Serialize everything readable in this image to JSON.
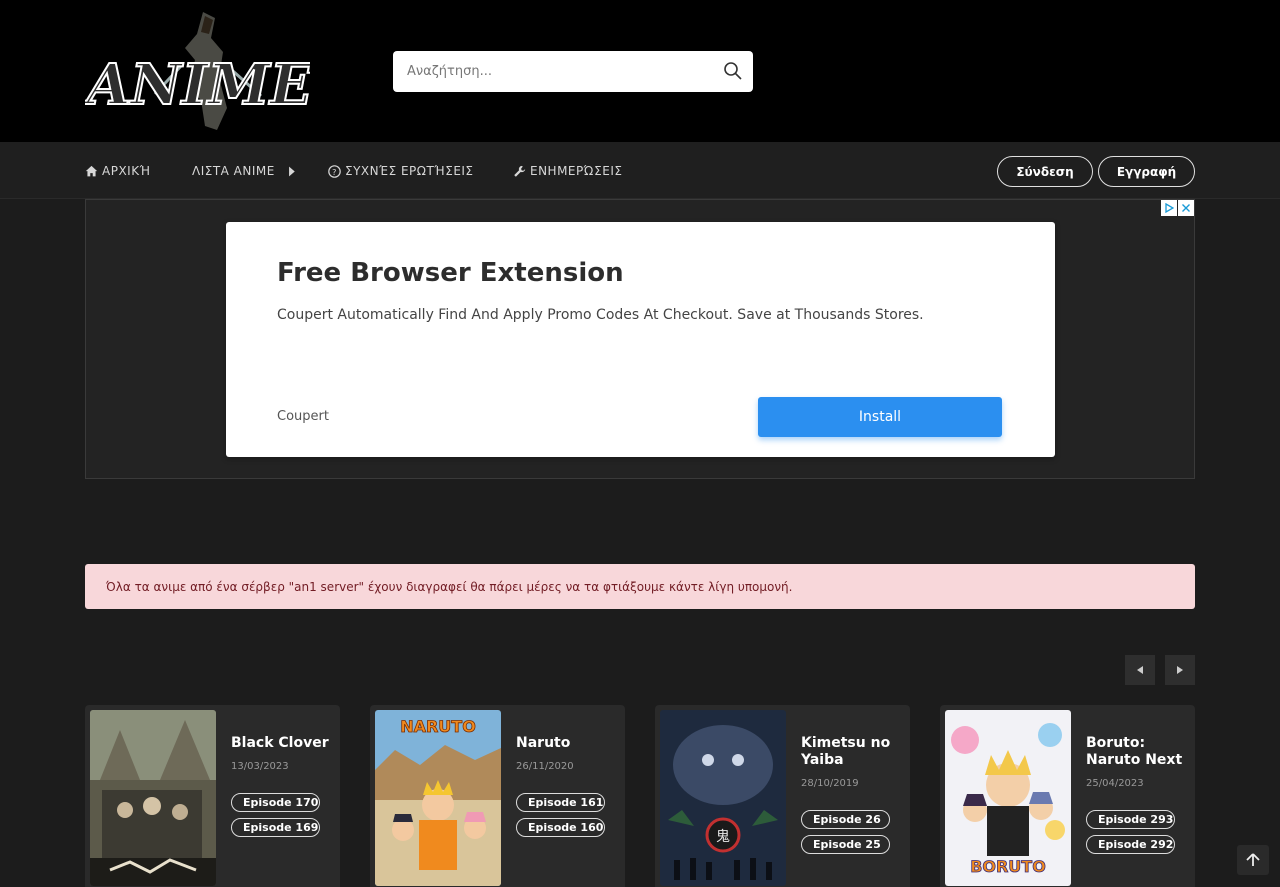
{
  "header": {
    "logo_text": "ANIME",
    "search_placeholder": "Αναζήτηση..."
  },
  "nav": {
    "items": [
      {
        "label": "ΑΡΧΙΚΉ",
        "icon": "home-icon"
      },
      {
        "label": "ΛΙΣΤΑ ANIME",
        "icon": "caret-right-icon"
      },
      {
        "label": "ΣΥΧΝΈΣ ΕΡΩΤΉΣΕΙΣ",
        "icon": "question-circle-icon"
      },
      {
        "label": "ΕΝΗΜΕΡΏΣΕΙΣ",
        "icon": "wrench-icon"
      }
    ],
    "login_label": "Σύνδεση",
    "register_label": "Εγγραφή"
  },
  "ad": {
    "title": "Free Browser Extension",
    "description": "Coupert Automatically Find And Apply Promo Codes At Checkout. Save at Thousands Stores.",
    "brand": "Coupert",
    "install_label": "Install"
  },
  "notice": {
    "text": "Όλα τα ανιμε από ένα σέρβερ \"an1 server\" έχουν διαγραφεί θα πάρει μέρες να τα φτιάξουμε κάντε λίγη υπομονή."
  },
  "carousel": {
    "cards": [
      {
        "title": "Black Clover",
        "date": "13/03/2023",
        "episodes": [
          "Episode 170",
          "Episode 169"
        ]
      },
      {
        "title": "Naruto",
        "date": "26/11/2020",
        "episodes": [
          "Episode 161",
          "Episode 160"
        ]
      },
      {
        "title": "Kimetsu no Yaiba",
        "date": "28/10/2019",
        "episodes": [
          "Episode 26",
          "Episode 25"
        ]
      },
      {
        "title": "Boruto: Naruto Next Generations",
        "date": "25/04/2023",
        "episodes": [
          "Episode 293",
          "Episode 292"
        ]
      }
    ]
  },
  "colors": {
    "topbar_bg": "#000000",
    "nav_bg": "#1f1f1f",
    "page_bg": "#1c1c1c",
    "notice_bg": "#f8d7da",
    "notice_text": "#721c24",
    "install_blue": "#2b8ff0"
  }
}
